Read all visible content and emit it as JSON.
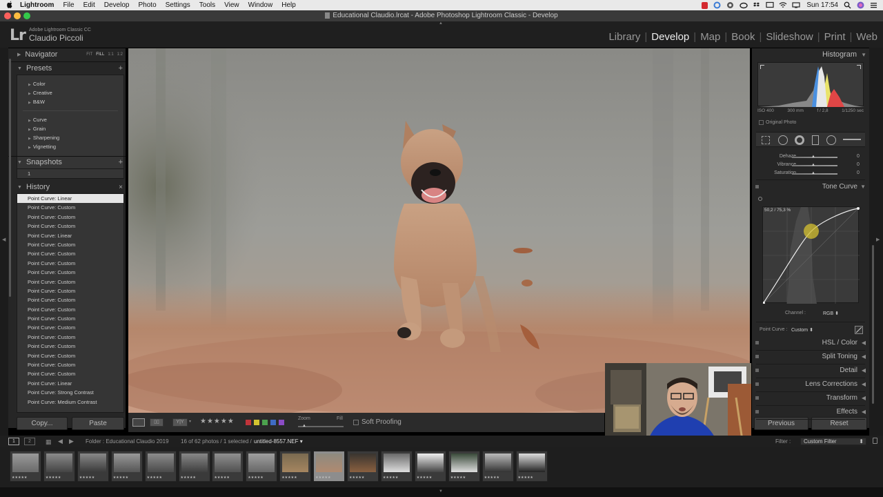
{
  "menubar": {
    "apple": "",
    "app": "Lightroom",
    "items": [
      "File",
      "Edit",
      "Develop",
      "Photo",
      "Settings",
      "Tools",
      "View",
      "Window",
      "Help"
    ],
    "clock": "Sun 17:54"
  },
  "window": {
    "title": "Educational Claudio.lrcat - Adobe Photoshop Lightroom Classic - Develop"
  },
  "identity": {
    "logo": "Lr",
    "product": "Adobe Lightroom Classic CC",
    "user": "Claudio Piccoli"
  },
  "modules": [
    {
      "label": "Library"
    },
    {
      "label": "Develop",
      "active": true
    },
    {
      "label": "Map"
    },
    {
      "label": "Book"
    },
    {
      "label": "Slideshow"
    },
    {
      "label": "Print"
    },
    {
      "label": "Web"
    }
  ],
  "left": {
    "navigator": {
      "title": "Navigator",
      "zooms": [
        "FIT",
        "FILL",
        "1:1",
        "1:2"
      ]
    },
    "presets": {
      "title": "Presets",
      "groups1": [
        "Color",
        "Creative",
        "B&W"
      ],
      "groups2": [
        "Curve",
        "Grain",
        "Sharpening",
        "Vignetting"
      ]
    },
    "snapshots": {
      "title": "Snapshots",
      "items": [
        "1"
      ]
    },
    "history": {
      "title": "History",
      "items": [
        "Point Curve: Linear",
        "Point Curve: Custom",
        "Point Curve: Custom",
        "Point Curve: Custom",
        "Point Curve: Linear",
        "Point Curve: Custom",
        "Point Curve: Custom",
        "Point Curve: Custom",
        "Point Curve: Custom",
        "Point Curve: Custom",
        "Point Curve: Custom",
        "Point Curve: Custom",
        "Point Curve: Custom",
        "Point Curve: Custom",
        "Point Curve: Custom",
        "Point Curve: Custom",
        "Point Curve: Custom",
        "Point Curve: Custom",
        "Point Curve: Custom",
        "Point Curve: Custom",
        "Point Curve: Linear",
        "Point Curve: Strong Contrast",
        "Point Curve: Medium Contrast"
      ]
    },
    "copy": "Copy...",
    "paste": "Paste"
  },
  "toolbar": {
    "zoom_label": "Zoom",
    "fill_label": "Fill",
    "soft_proofing": "Soft Proofing",
    "stars": "★★★★★"
  },
  "right": {
    "histogram": {
      "title": "Histogram",
      "iso": "ISO 400",
      "focal": "300 mm",
      "aperture": "f / 2,8",
      "shutter": "1/1250 sec",
      "original": "Original Photo"
    },
    "presence": [
      {
        "label": "Dehaze",
        "value": "0"
      },
      {
        "label": "Vibrance",
        "value": "0"
      },
      {
        "label": "Saturation",
        "value": "0"
      }
    ],
    "tone_curve": {
      "title": "Tone Curve",
      "readout": "50,2 / 75,3 %",
      "channel_label": "Channel :",
      "channel": "RGB",
      "point_curve_label": "Point Curve :",
      "point_curve": "Custom"
    },
    "sections": [
      "HSL / Color",
      "Split Toning",
      "Detail",
      "Lens Corrections",
      "Transform",
      "Effects"
    ],
    "previous": "Previous",
    "reset": "Reset"
  },
  "filmstrip_bar": {
    "folder": "Folder : Educational Claudio 2019",
    "count": "16 of 62 photos / 1 selected /",
    "file": "untitled-8557.NEF",
    "filter_label": "Filter :",
    "filter": "Custom Filter",
    "pages": [
      "1",
      "2"
    ]
  },
  "filmstrip": {
    "stars": "★★★★★",
    "count": 16,
    "selected_index": 9
  }
}
